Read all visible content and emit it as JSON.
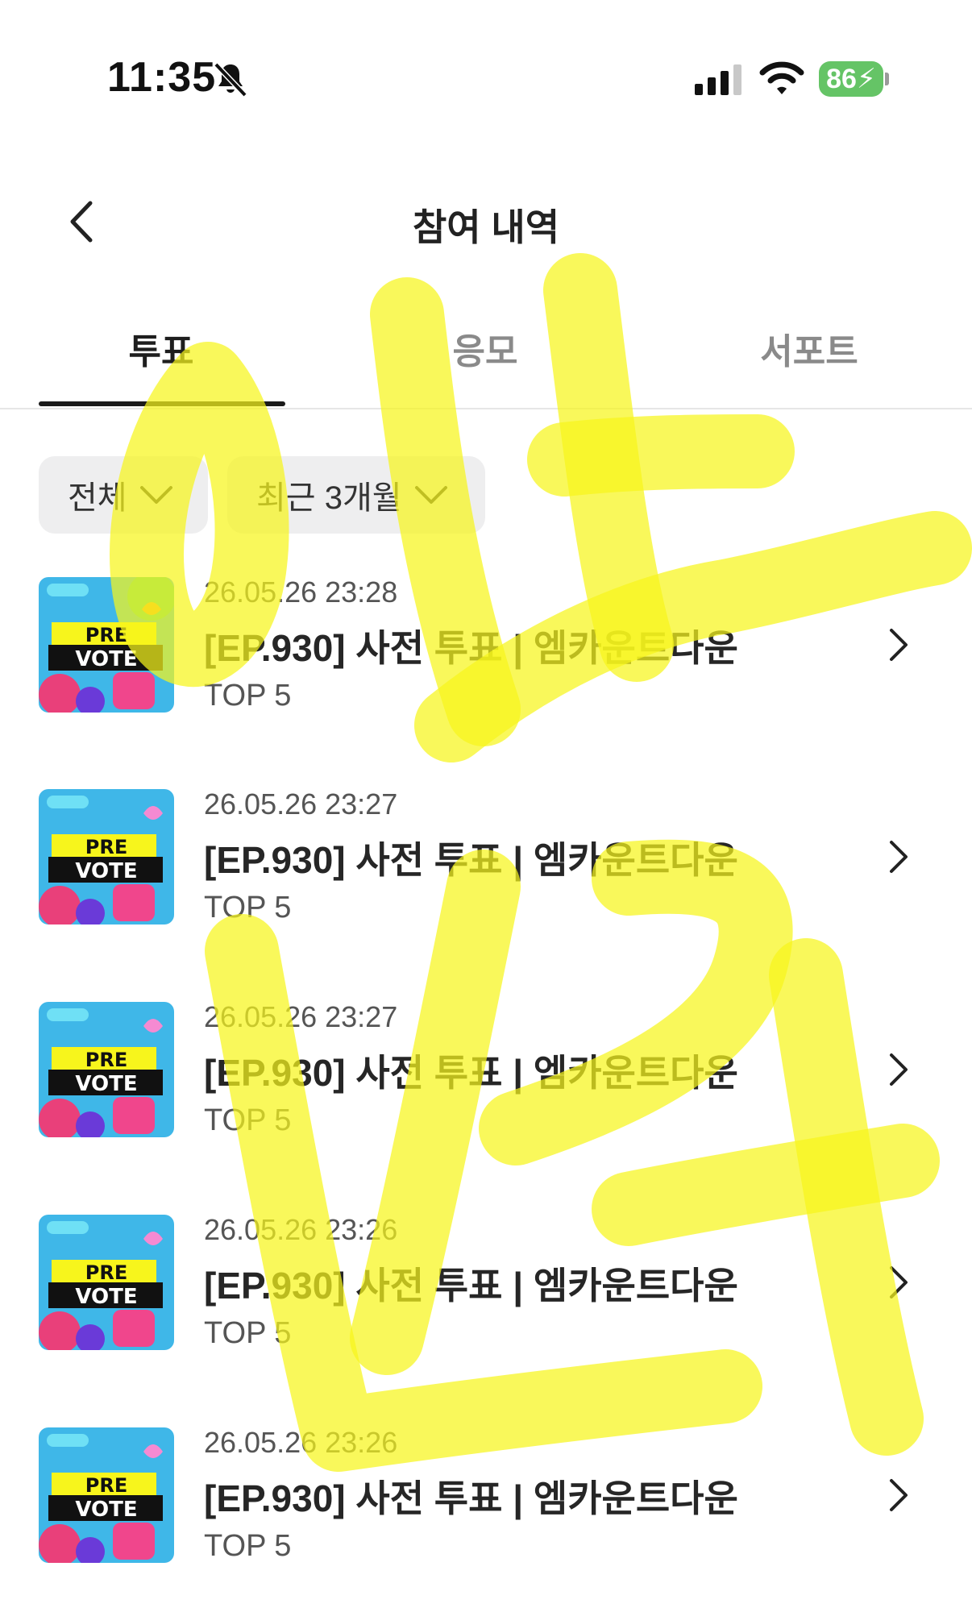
{
  "status_bar": {
    "time": "11:35",
    "battery": "86"
  },
  "header": {
    "title": "참여 내역"
  },
  "tabs": [
    {
      "label": "투표",
      "active": true
    },
    {
      "label": "응모",
      "active": false
    },
    {
      "label": "서포트",
      "active": false
    }
  ],
  "filters": [
    {
      "label": "전체"
    },
    {
      "label": "최근 3개월"
    }
  ],
  "thumbnail": {
    "line1": "PRE",
    "line2": "VOTE"
  },
  "items": [
    {
      "date": "26.05.26 23:28",
      "title": "[EP.930] 사전 투표 | 엠카운트다운",
      "subtitle": "TOP 5"
    },
    {
      "date": "26.05.26 23:27",
      "title": "[EP.930] 사전 투표 | 엠카운트다운",
      "subtitle": "TOP 5"
    },
    {
      "date": "26.05.26 23:27",
      "title": "[EP.930] 사전 투표 | 엠카운트다운",
      "subtitle": "TOP 5"
    },
    {
      "date": "26.05.26 23:26",
      "title": "[EP.930] 사전 투표 | 엠카운트다운",
      "subtitle": "TOP 5"
    },
    {
      "date": "26.05.26 23:26",
      "title": "[EP.930] 사전 투표 | 엠카운트다운",
      "subtitle": "TOP 5"
    }
  ],
  "colors": {
    "highlighter": "#f7f51c",
    "battery": "#65c466",
    "text": "#262626"
  }
}
